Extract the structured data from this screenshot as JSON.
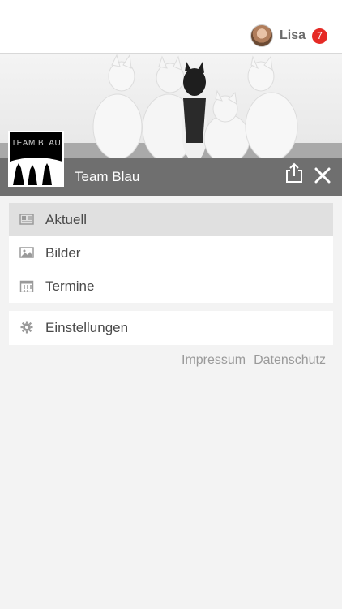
{
  "header": {
    "user_name": "Lisa",
    "notification_count": "7"
  },
  "team": {
    "name": "Team Blau",
    "logo_text": "TEAM BLAU"
  },
  "menu": {
    "items": [
      {
        "label": "Aktuell",
        "icon": "newspaper-icon",
        "active": true
      },
      {
        "label": "Bilder",
        "icon": "image-icon",
        "active": false
      },
      {
        "label": "Termine",
        "icon": "calendar-icon",
        "active": false
      }
    ],
    "settings_label": "Einstellungen"
  },
  "footer": {
    "impressum": "Impressum",
    "datenschutz": "Datenschutz"
  },
  "colors": {
    "badge": "#e52a25",
    "team_bar": "#6f6f6f",
    "active_item": "#e0e0e0",
    "background": "#f3f3f3"
  }
}
